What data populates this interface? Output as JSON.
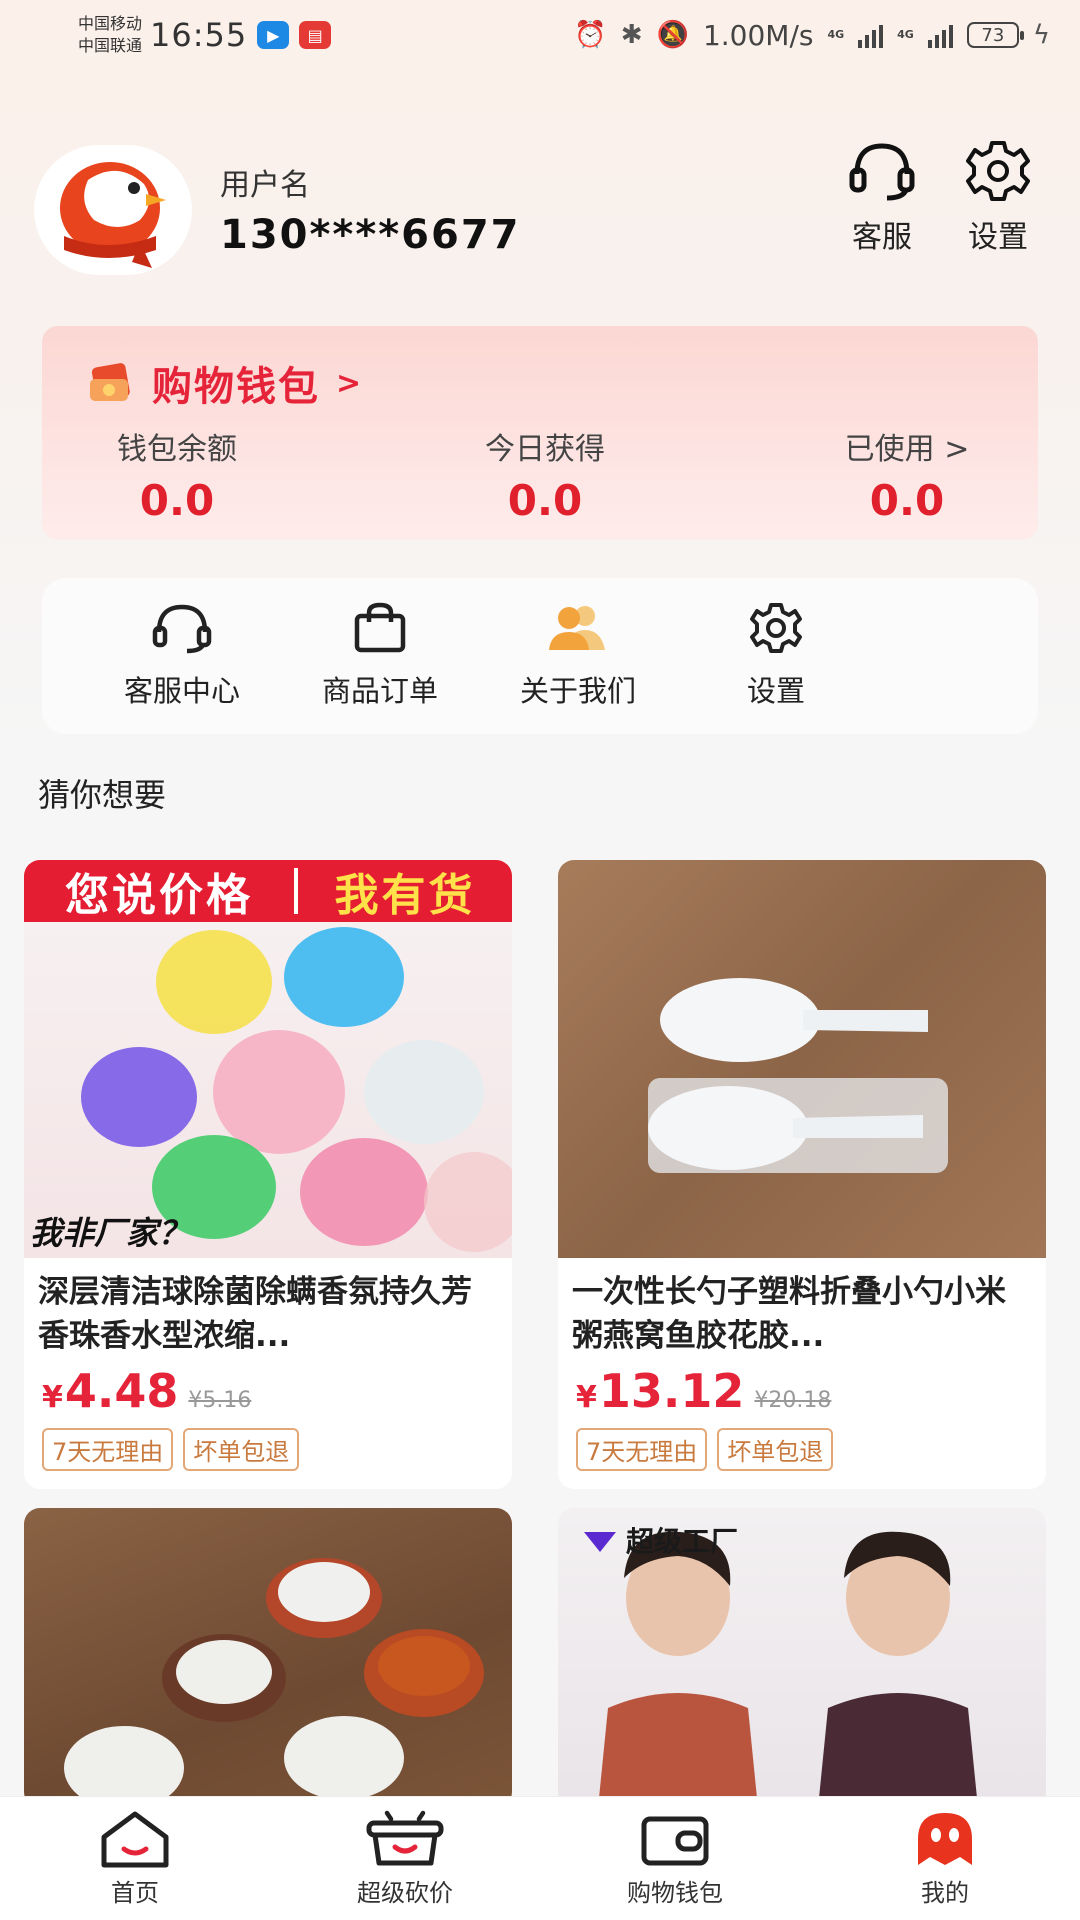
{
  "status_bar": {
    "carrier1": "中国移动",
    "carrier2": "中国联通",
    "time": "16:55",
    "speed": "1.00M/s",
    "signal_tag": "4G",
    "battery": "73"
  },
  "profile": {
    "username_label": "用户名",
    "phone": "130****6677",
    "service_label": "客服",
    "settings_label": "设置"
  },
  "wallet": {
    "title": "购物钱包",
    "arrow": ">",
    "balance_label": "钱包余额",
    "balance_value": "0.0",
    "today_label": "今日获得",
    "today_value": "0.0",
    "used_label": "已使用 >",
    "used_value": "0.0"
  },
  "quick_menu": [
    {
      "label": "客服中心",
      "icon": "headset-icon"
    },
    {
      "label": "商品订单",
      "icon": "shopping-bag-icon"
    },
    {
      "label": "关于我们",
      "icon": "people-icon"
    },
    {
      "label": "设置",
      "icon": "gear-icon"
    }
  ],
  "guess": {
    "title": "猜你想要"
  },
  "products": [
    {
      "banner_left": "您说价格",
      "banner_right": "我有货",
      "caption": "我非厂家？",
      "name": "深层清洁球除菌除螨香氛持久芳香珠香水型浓缩...",
      "yen": "¥",
      "price": "4.48",
      "old_price": "¥5.16",
      "tag1": "7天无理由",
      "tag2": "坏单包退"
    },
    {
      "name": "一次性长勺子塑料折叠小勺小米粥燕窝鱼胶花胶...",
      "yen": "¥",
      "price": "13.12",
      "old_price": "¥20.18",
      "tag1": "7天无理由",
      "tag2": "坏单包退"
    },
    {},
    {
      "badge": "超级工厂"
    }
  ],
  "tabbar": [
    {
      "label": "首页",
      "icon": "home-icon"
    },
    {
      "label": "超级砍价",
      "icon": "pot-icon"
    },
    {
      "label": "购物钱包",
      "icon": "wallet-icon"
    },
    {
      "label": "我的",
      "icon": "profile-mascot-icon"
    }
  ],
  "colors": {
    "accent_red": "#e5243a",
    "tag_orange": "#c97a3e"
  }
}
